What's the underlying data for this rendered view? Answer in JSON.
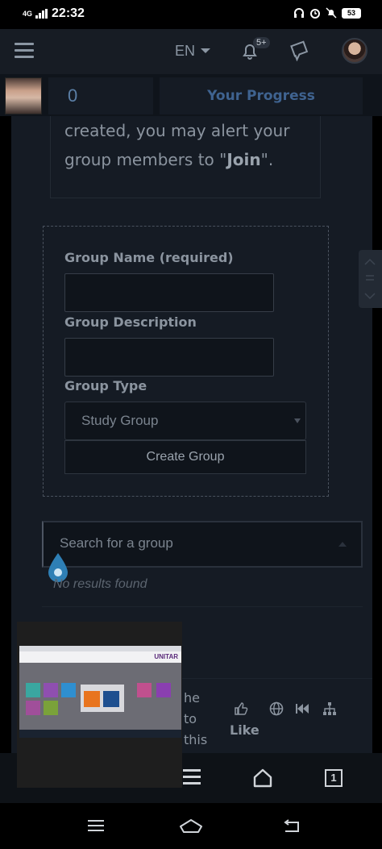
{
  "status_bar": {
    "network": "4G",
    "time": "22:32",
    "battery": "53"
  },
  "header": {
    "language": "EN",
    "notification_badge": "5+"
  },
  "progress": {
    "count": "0",
    "title": "Your Progress"
  },
  "intro": {
    "line1": "created, you may alert your",
    "line2_prefix": "group members to \"",
    "line2_bold": "Join",
    "line2_suffix": "\"."
  },
  "form": {
    "group_name_label": "Group Name (required)",
    "group_name_value": "",
    "group_description_label": "Group Description",
    "group_description_value": "",
    "group_type_label": "Group Type",
    "group_type_selected": "Study Group",
    "create_button": "Create Group"
  },
  "search": {
    "placeholder": "Search for a group",
    "no_results": "No results found"
  },
  "bottom_snippet": {
    "line1": "he",
    "line2": "to",
    "line3": "this",
    "like_label": "Like"
  },
  "overlay": {
    "brand": "UNITAR"
  },
  "bottom_nav": {
    "tab_count": "1"
  },
  "colors": {
    "page_bg": "#151b24",
    "header_bg": "#171c24",
    "accent_blue": "#3f6390",
    "drop_icon": "#2e7fb5"
  }
}
